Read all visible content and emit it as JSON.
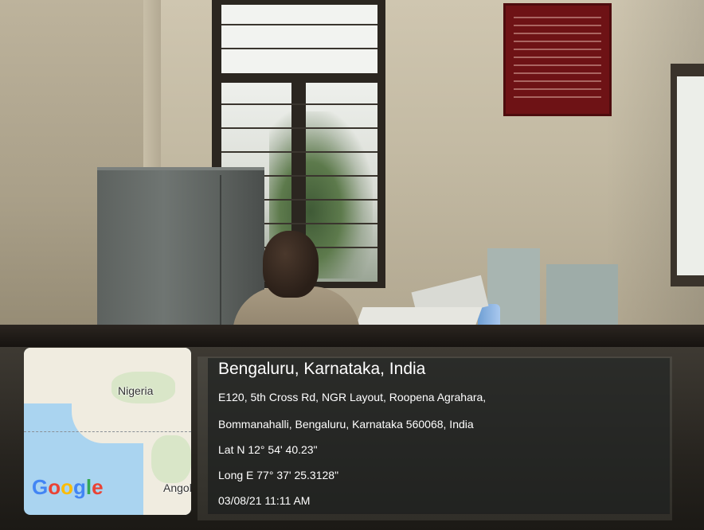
{
  "location": {
    "title": "Bengaluru, Karnataka, India",
    "address_line_1": "E120, 5th Cross Rd, NGR Layout, Roopena Agrahara,",
    "address_line_2": "Bommanahalli, Bengaluru, Karnataka 560068, India",
    "latitude": "Lat N 12° 54' 40.23\"",
    "longitude": "Long E 77° 37' 25.3128\"",
    "timestamp": "03/08/21 11:11 AM"
  },
  "map": {
    "label_nigeria": "Nigeria",
    "label_angola": "Angol",
    "logo": [
      "G",
      "o",
      "o",
      "g",
      "l",
      "e"
    ],
    "logo_colors": [
      "#4285F4",
      "#EA4335",
      "#FBBC05",
      "#4285F4",
      "#34A853",
      "#EA4335"
    ]
  },
  "photo": {
    "subject": "office scene"
  }
}
